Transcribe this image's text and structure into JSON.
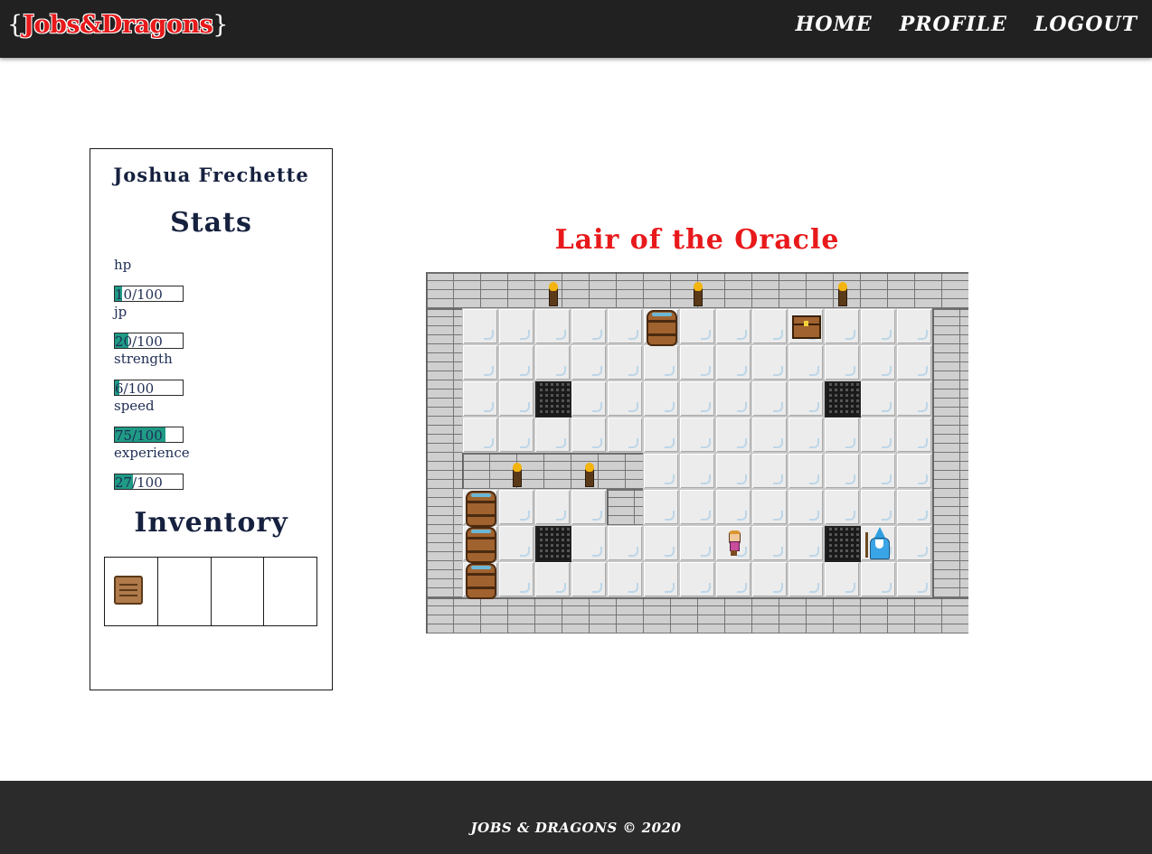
{
  "nav": {
    "logo_open": "{",
    "logo_name": "Jobs&Dragons",
    "logo_close": "}",
    "links": [
      "HOME",
      "PROFILE",
      "LOGOUT"
    ]
  },
  "player": {
    "name": "Joshua Frechette",
    "stats_heading": "Stats",
    "stats": [
      {
        "label": "hp",
        "value": 10,
        "max": 100,
        "text": "10/100"
      },
      {
        "label": "jp",
        "value": 20,
        "max": 100,
        "text": "20/100"
      },
      {
        "label": "strength",
        "value": 6,
        "max": 100,
        "text": "6/100"
      },
      {
        "label": "speed",
        "value": 75,
        "max": 100,
        "text": "75/100"
      },
      {
        "label": "experience",
        "value": 27,
        "max": 100,
        "text": "27/100"
      }
    ],
    "inventory_heading": "Inventory",
    "inventory": [
      "scroll-icon",
      "",
      "",
      ""
    ]
  },
  "game": {
    "title": "Lair of the Oracle",
    "accent": "#e8191b",
    "stat_fill_color": "#1f9b86"
  },
  "footer": {
    "text": "JOBS & DRAGONS © 2020"
  }
}
